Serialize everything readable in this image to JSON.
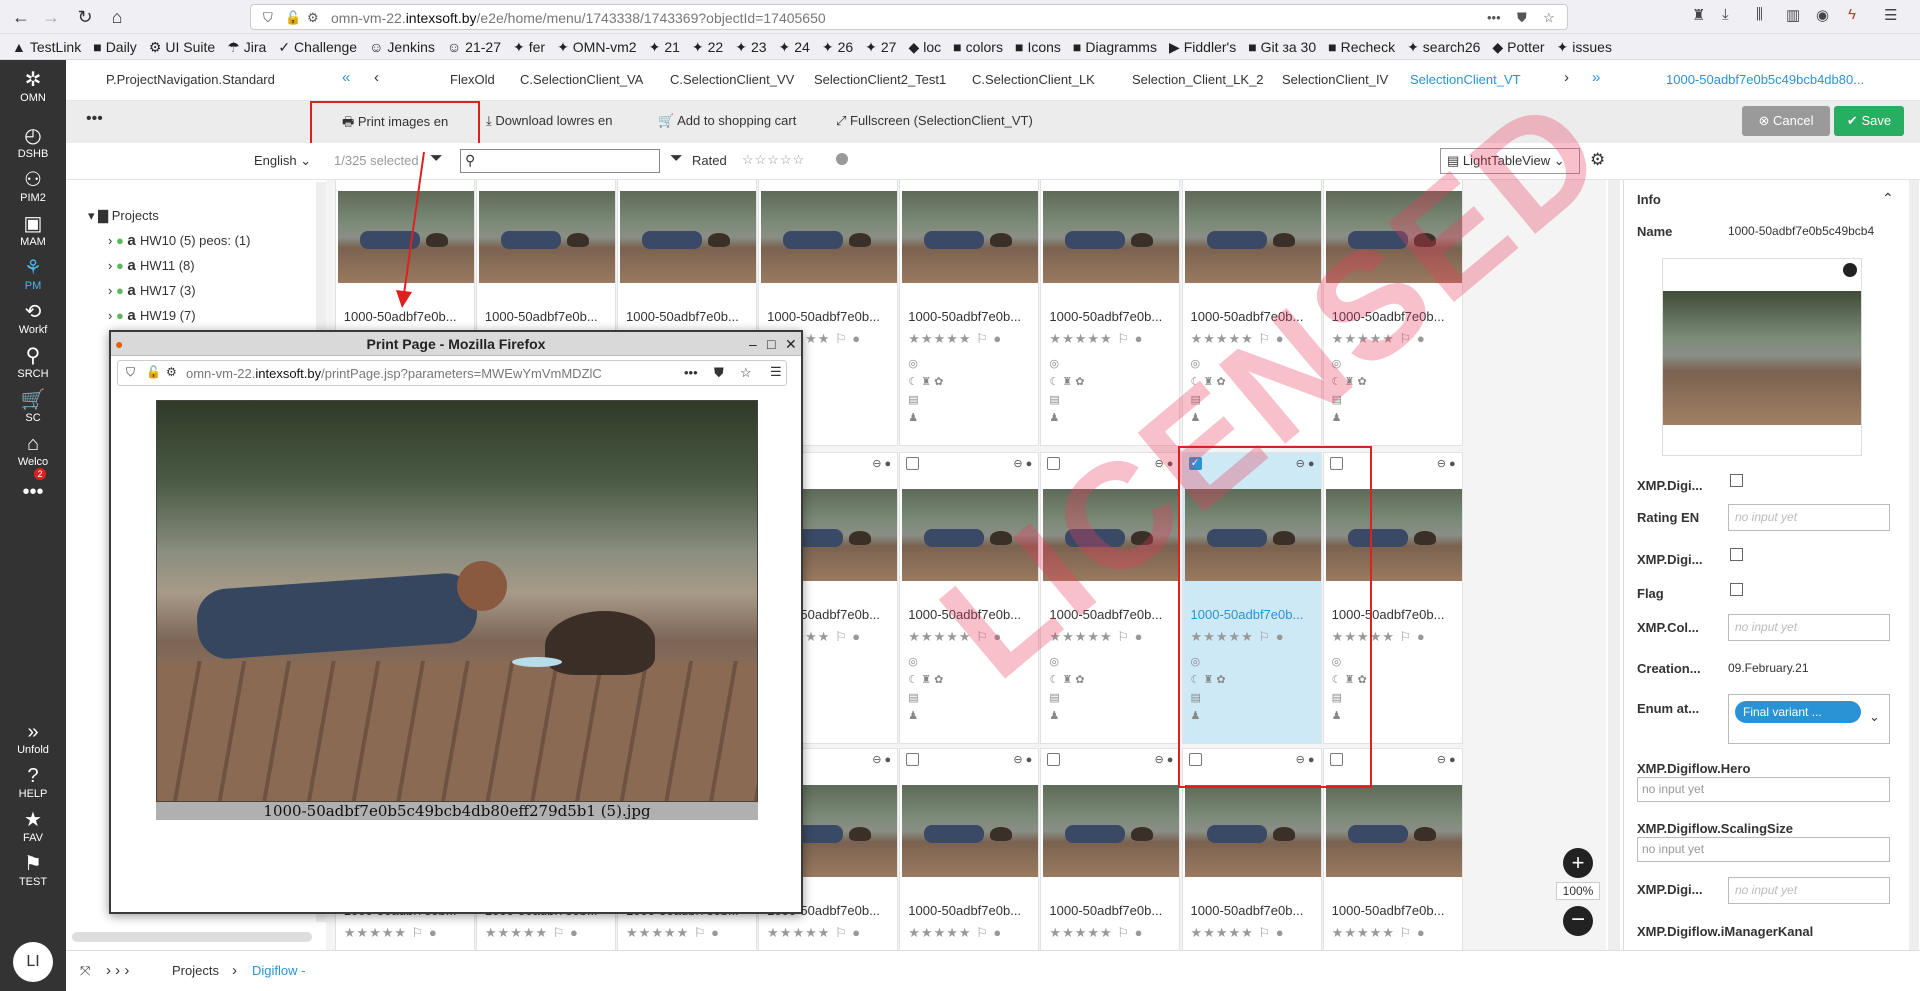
{
  "browser": {
    "url_prefix": "omn-vm-22.",
    "url_domain": "intexsoft.by",
    "url_path": "/e2e/home/menu/1743338/1743369?objectId=17405650",
    "bookmarks": [
      "TestLink",
      "Daily",
      "UI Suite",
      "Jira",
      "Challenge",
      "Jenkins",
      "21-27",
      "fer",
      "OMN-vm2",
      "21",
      "22",
      "23",
      "24",
      "26",
      "27",
      "loc",
      "colors",
      "Icons",
      "Diagramms",
      "Fiddler's",
      "Git за 30",
      "Recheck",
      "search26",
      "Potter",
      "issues"
    ]
  },
  "rail": {
    "logo": "OMN",
    "items": [
      "DSHB",
      "PIM2",
      "MAM",
      "PM",
      "Workf",
      "SRCH",
      "SC",
      "Welco",
      "..."
    ],
    "bottom": [
      "Unfold",
      "HELP",
      "FAV",
      "TEST"
    ],
    "sc_badge": "2",
    "avatar": "LI"
  },
  "tabs": {
    "left": "P.ProjectNavigation.Standard",
    "items": [
      "FlexOld",
      "C.SelectionClient_VA",
      "C.SelectionClient_VV",
      "SelectionClient2_Test1",
      "C.SelectionClient_LK",
      "Selection_Client_LK_2",
      "SelectionClient_IV",
      "SelectionClient_VT"
    ],
    "right": "1000-50adbf7e0b5c49bcb4db80..."
  },
  "toolbar": {
    "print": "Print images en",
    "download": "Download lowres en",
    "cart": "Add to shopping cart",
    "fullscreen": "Fullscreen (SelectionClient_VT)",
    "cancel": "Cancel",
    "save": "Save"
  },
  "filter": {
    "language": "English",
    "selected": "1/325 selected",
    "rated": "Rated",
    "view": "LightTableView"
  },
  "tree": {
    "root": "Projects",
    "items": [
      "HW10 (5) peos: (1)",
      "HW11 (8)",
      "HW17 (3)",
      "HW19 (7)"
    ]
  },
  "tile_name": "1000-50adbf7e0b...",
  "stamp_text": "LICENSED",
  "panel": {
    "info": "Info",
    "name_label": "Name",
    "name_value": "1000-50adbf7e0b5c49bcb4",
    "xmp1": "XMP.Digi...",
    "rating": "Rating EN",
    "xmp2": "XMP.Digi...",
    "flag": "Flag",
    "xmpcol": "XMP.Col...",
    "creation": "Creation...",
    "creation_value": "09.February.21",
    "enum": "Enum at...",
    "enum_chip": "Final variant ...",
    "hero": "XMP.Digiflow.Hero",
    "scaling": "XMP.Digiflow.ScalingSize",
    "xmp3": "XMP.Digi...",
    "kanal": "XMP.Digiflow.iManagerKanal",
    "placeholder": "no input yet",
    "zoom": "100%"
  },
  "status": {
    "projects": "Projects",
    "digiflow": "Digiflow -"
  },
  "popup": {
    "title": "Print Page - Mozilla Firefox",
    "url_prefix": "omn-vm-22.",
    "url_domain": "intexsoft.by",
    "url_path": "/printPage.jsp?parameters=MWEwYmVmMDZlC",
    "caption": "1000-50adbf7e0b5c49bcb4db80eff279d5b1 (5).jpg"
  }
}
